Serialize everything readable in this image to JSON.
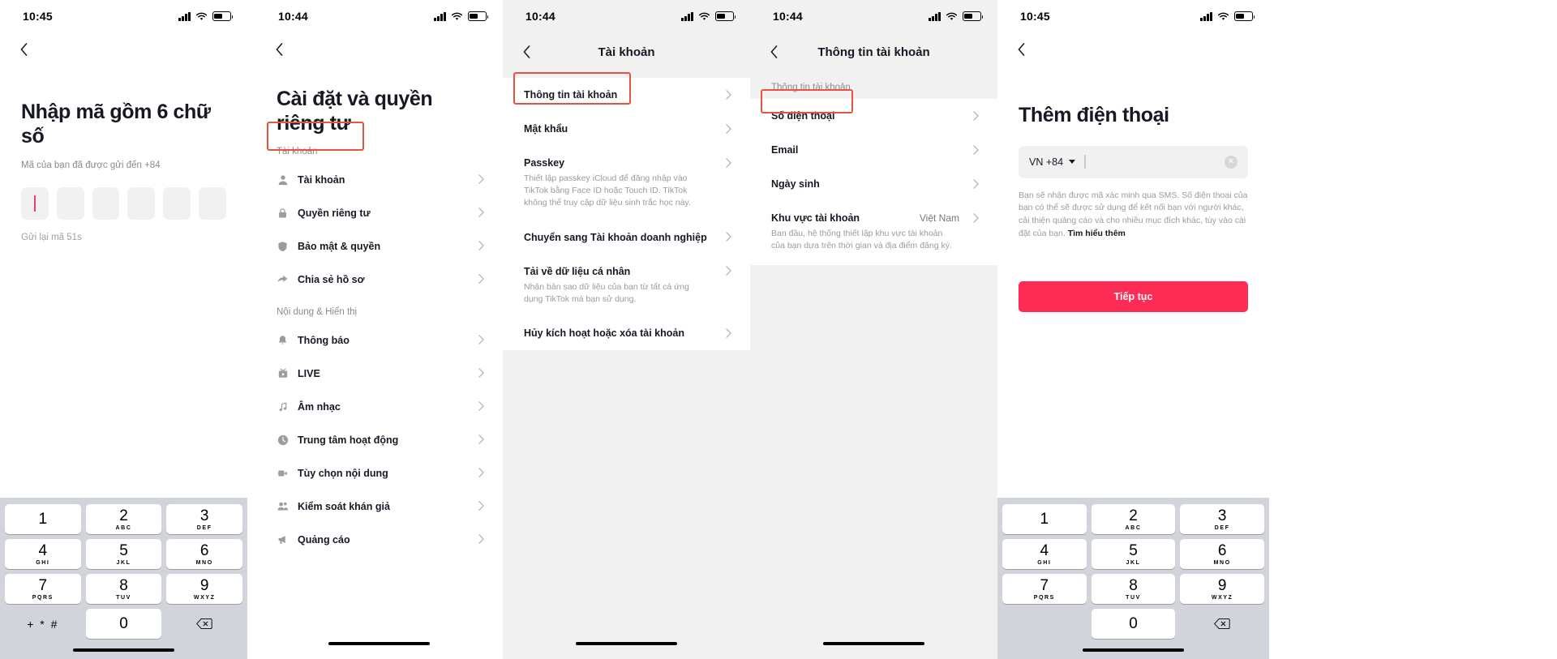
{
  "panels": {
    "otp": {
      "status": {
        "time": "10:45",
        "battery_icon": "battery-icon",
        "wifi_icon": "wifi-icon",
        "signal_icon": "signal-bars-icon"
      },
      "back_icon": "chevron-left-icon",
      "title": "Nhập mã gồm 6 chữ số",
      "subtitle": "Mã của bạn đã được gửi đến +84",
      "code_cells": [
        "",
        "",
        "",
        "",
        "",
        ""
      ],
      "resend": "Gửi lại mã  51s"
    },
    "settings": {
      "status": {
        "time": "10:44"
      },
      "back_icon": "chevron-left-icon",
      "title": "Cài đặt và quyền riêng tư",
      "sections": [
        {
          "label": "Tài khoản",
          "items": [
            {
              "icon": "person-icon",
              "label": "Tài khoản",
              "highlighted": true
            },
            {
              "icon": "lock-icon",
              "label": "Quyền riêng tư",
              "highlighted": false
            },
            {
              "icon": "shield-icon",
              "label": "Bảo mật & quyền",
              "highlighted": false
            },
            {
              "icon": "share-arrow-icon",
              "label": "Chia sẻ hồ sơ",
              "highlighted": false
            }
          ]
        },
        {
          "label": "Nội dung & Hiển thị",
          "items": [
            {
              "icon": "bell-icon",
              "label": "Thông báo",
              "highlighted": false
            },
            {
              "icon": "live-tv-icon",
              "label": "LIVE",
              "highlighted": false
            },
            {
              "icon": "music-note-icon",
              "label": "Âm nhạc",
              "highlighted": false
            },
            {
              "icon": "clock-icon",
              "label": "Trung tâm hoạt động",
              "highlighted": false
            },
            {
              "icon": "video-camera-icon",
              "label": "Tùy chọn nội dung",
              "highlighted": false
            },
            {
              "icon": "people-icon",
              "label": "Kiểm soát khán giả",
              "highlighted": false
            },
            {
              "icon": "megaphone-icon",
              "label": "Quảng cáo",
              "highlighted": false
            }
          ]
        }
      ]
    },
    "account": {
      "status": {
        "time": "10:44"
      },
      "back_icon": "chevron-left-icon",
      "nav_title": "Tài khoản",
      "items": [
        {
          "label": "Thông tin tài khoản",
          "desc": "",
          "highlighted": true
        },
        {
          "label": "Mật khẩu",
          "desc": "",
          "highlighted": false
        },
        {
          "label": "Passkey",
          "desc": "Thiết lập passkey iCloud để đăng nhập vào TikTok bằng Face ID hoặc Touch ID. TikTok không thể truy cập dữ liệu sinh trắc học này.",
          "highlighted": false
        },
        {
          "label": "Chuyển sang Tài khoản doanh nghiệp",
          "desc": "",
          "highlighted": false
        },
        {
          "label": "Tải về dữ liệu cá nhân",
          "desc": "Nhận bản sao dữ liệu của bạn từ tất cả ứng dụng TikTok mà bạn sử dụng.",
          "highlighted": false
        },
        {
          "label": "Hủy kích hoạt hoặc xóa tài khoản",
          "desc": "",
          "highlighted": false
        }
      ]
    },
    "account_info": {
      "status": {
        "time": "10:44"
      },
      "back_icon": "chevron-left-icon",
      "nav_title": "Thông tin tài khoản",
      "section_label": "Thông tin tài khoản",
      "items": [
        {
          "label": "Số điện thoại",
          "value": "",
          "desc": "",
          "highlighted": true
        },
        {
          "label": "Email",
          "value": "",
          "desc": "",
          "highlighted": false
        },
        {
          "label": "Ngày sinh",
          "value": "",
          "desc": "",
          "highlighted": false
        },
        {
          "label": "Khu vực tài khoản",
          "value": "Việt Nam",
          "desc": "Ban đầu, hệ thống thiết lập khu vực tài khoản của bạn dựa trên thời gian và địa điểm đăng ký.",
          "highlighted": false
        }
      ]
    },
    "add_phone": {
      "status": {
        "time": "10:45"
      },
      "back_icon": "chevron-left-icon",
      "title": "Thêm điện thoại",
      "country_code": "VN +84",
      "phone_placeholder": "",
      "clear_icon": "clear-circle-icon",
      "legal_text": "Bạn sẽ nhận được mã xác minh qua SMS. Số điện thoại của bạn có thể sẽ được sử dụng để kết nối bạn với người khác, cải thiện quảng cáo và cho nhiều mục đích khác, tùy vào cài đặt của bạn. ",
      "legal_link": "Tìm hiểu thêm",
      "cta_label": "Tiếp tục"
    }
  },
  "keypad": {
    "keys": [
      {
        "num": "1",
        "letters": ""
      },
      {
        "num": "2",
        "letters": "ABC"
      },
      {
        "num": "3",
        "letters": "DEF"
      },
      {
        "num": "4",
        "letters": "GHI"
      },
      {
        "num": "5",
        "letters": "JKL"
      },
      {
        "num": "6",
        "letters": "MNO"
      },
      {
        "num": "7",
        "letters": "PQRS"
      },
      {
        "num": "8",
        "letters": "TUV"
      },
      {
        "num": "9",
        "letters": "WXYZ"
      },
      {
        "num": "0",
        "letters": ""
      }
    ],
    "symbol_key": "+ * #",
    "delete_icon": "backspace-icon"
  },
  "colors": {
    "accent_pink": "#fe2c55",
    "highlight_red": "#e8533f",
    "keypad_bg": "#d1d4db",
    "page_bg": "#f1f1f2",
    "text_primary": "#161823",
    "text_muted": "#8a8b91"
  }
}
